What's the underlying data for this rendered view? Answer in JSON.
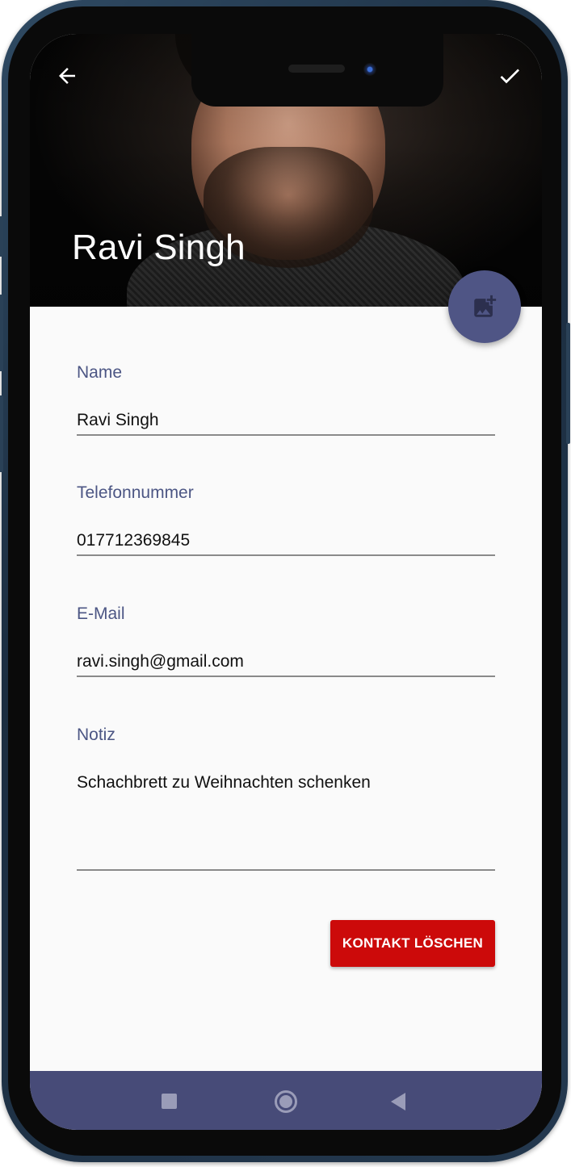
{
  "header": {
    "title": "Ravi Singh",
    "back_icon": "arrow-left-icon",
    "confirm_icon": "check-icon",
    "photo_change_icon": "add-photo-icon"
  },
  "form": {
    "fields": [
      {
        "label": "Name",
        "value": "Ravi Singh"
      },
      {
        "label": "Telefonnummer",
        "value": "017712369845"
      },
      {
        "label": "E-Mail",
        "value": "ravi.singh@gmail.com"
      },
      {
        "label": "Notiz",
        "value": "Schachbrett zu Weihnachten schenken"
      }
    ],
    "delete_label": "KONTAKT LÖSCHEN"
  },
  "navbar": {
    "recents_icon": "square-icon",
    "home_icon": "circle-icon",
    "back_icon": "triangle-back-icon"
  },
  "colors": {
    "accent": "#4f5585",
    "label": "#4c5684",
    "danger": "#cc0a0a",
    "navbar": "#474b78"
  }
}
